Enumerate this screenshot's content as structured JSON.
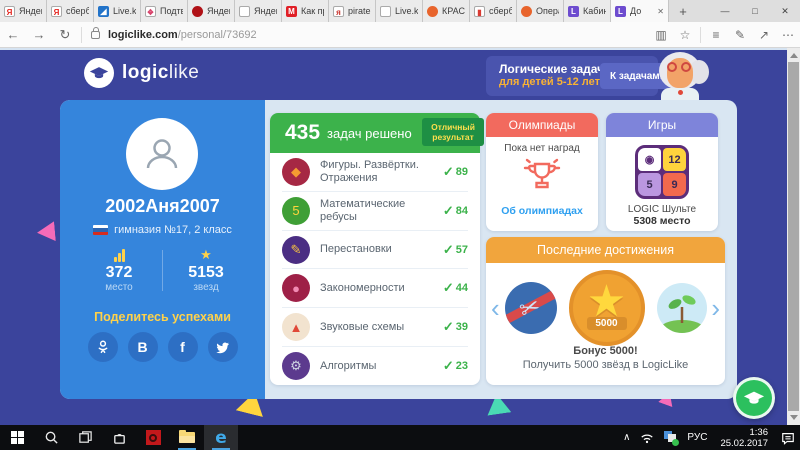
{
  "browser": {
    "tabs": [
      {
        "label": "Яндекс",
        "active": false,
        "icon": {
          "shape": "square",
          "bg": "#ffffff",
          "fg": "#e52620",
          "glyph": "Я",
          "border": true,
          "name": "yandex-favicon"
        }
      },
      {
        "label": "сберб",
        "active": false,
        "icon": {
          "shape": "square",
          "bg": "#ffffff",
          "fg": "#e52620",
          "glyph": "Я",
          "border": true,
          "name": "yandex-favicon"
        }
      },
      {
        "label": "Live.ka",
        "active": false,
        "icon": {
          "shape": "square",
          "bg": "#2273c9",
          "fg": "#ffffff",
          "glyph": "◢",
          "border": false,
          "name": "livejournal-favicon"
        }
      },
      {
        "label": "Подтв",
        "active": false,
        "icon": {
          "shape": "square",
          "bg": "#ffffff",
          "fg": "#d8426b",
          "glyph": "❖",
          "border": true,
          "name": "flower-favicon"
        }
      },
      {
        "label": "Яндекс",
        "active": false,
        "icon": {
          "shape": "circle",
          "bg": "#b01116",
          "fg": "#2a0a0a",
          "glyph": "",
          "border": false,
          "name": "red-circle-favicon"
        }
      },
      {
        "label": "Яндекс",
        "active": false,
        "icon": {
          "shape": "frame",
          "bg": "#ffffff",
          "fg": "#888888",
          "glyph": "",
          "border": true,
          "name": "window-favicon"
        }
      },
      {
        "label": "Как пр",
        "active": false,
        "icon": {
          "shape": "square",
          "bg": "#e01f26",
          "fg": "#ffffff",
          "glyph": "M",
          "border": false,
          "name": "mail-favicon"
        }
      },
      {
        "label": "pirate's",
        "active": false,
        "icon": {
          "shape": "square",
          "bg": "#ffffff",
          "fg": "#c9342e",
          "glyph": "я",
          "border": true,
          "name": "red-letter-favicon"
        }
      },
      {
        "label": "Live.ka",
        "active": false,
        "icon": {
          "shape": "frame",
          "bg": "#ffffff",
          "fg": "#888888",
          "glyph": "",
          "border": true,
          "name": "window-favicon"
        }
      },
      {
        "label": "КРАСИ",
        "active": false,
        "icon": {
          "shape": "circle",
          "bg": "#e8642c",
          "fg": "#ffffff",
          "glyph": "",
          "border": false,
          "name": "orange-favicon"
        }
      },
      {
        "label": "сберба",
        "active": false,
        "icon": {
          "shape": "square",
          "bg": "#ffffff",
          "fg": "#d93a32",
          "glyph": "▮",
          "border": true,
          "name": "sber-favicon"
        }
      },
      {
        "label": "Опера",
        "active": false,
        "icon": {
          "shape": "circle",
          "bg": "#e8642c",
          "fg": "#ffffff",
          "glyph": "",
          "border": false,
          "name": "opera-favicon"
        }
      },
      {
        "label": "Кабин",
        "active": false,
        "icon": {
          "shape": "square",
          "bg": "#6d4ccf",
          "fg": "#ffffff",
          "glyph": "L",
          "border": false,
          "name": "logiclike-favicon"
        }
      },
      {
        "label": "До",
        "active": true,
        "icon": {
          "shape": "square",
          "bg": "#6d4ccf",
          "fg": "#ffffff",
          "glyph": "L",
          "border": false,
          "name": "logiclike-favicon"
        }
      }
    ],
    "new_tab_glyph": "+",
    "close_glyph": "✕",
    "window_controls": {
      "minimize": "—",
      "maximize": "□",
      "close": "✕"
    },
    "toolbar": {
      "back": "←",
      "forward": "→",
      "refresh": "↻",
      "reading_view": "▥",
      "favorite": "☆",
      "hub": "≡",
      "web_note": "✎",
      "share": "↗",
      "more": "⋯"
    },
    "url": {
      "host": "logiclike.com",
      "path": "/personal/73692"
    }
  },
  "header": {
    "logo_bold": "logic",
    "logo_light": "like",
    "banner_line1": "Логические задачи",
    "banner_line2": "для детей 5-12 лет",
    "cta_label": "К задачам!"
  },
  "profile": {
    "name": "2002Аня2007",
    "school": "гимназия №17, 2 класс",
    "rank_value": "372",
    "rank_label": "место",
    "stars_value": "5153",
    "stars_label": "звезд",
    "share_title": "Поделитесь успехами",
    "social": [
      "odnoklassniki",
      "vkontakte",
      "facebook",
      "twitter"
    ]
  },
  "tasks": {
    "count": "435",
    "count_label": "задач решено",
    "badge_line1": "Отличный",
    "badge_line2": "результат",
    "check_glyph": "✓",
    "items": [
      {
        "label": "Фигуры. Развёртки. Отражения",
        "value": "89",
        "icon": {
          "bg": "#a62844",
          "fg": "#f59b31",
          "glyph": "◆"
        }
      },
      {
        "label": "Математические ребусы",
        "value": "84",
        "icon": {
          "bg": "#3f9f36",
          "fg": "#ffd43d",
          "glyph": "5"
        }
      },
      {
        "label": "Перестановки",
        "value": "57",
        "icon": {
          "bg": "#4b2e83",
          "fg": "#f5c242",
          "glyph": "✎"
        }
      },
      {
        "label": "Закономерности",
        "value": "44",
        "icon": {
          "bg": "#9e2047",
          "fg": "#f28bb4",
          "glyph": "●"
        }
      },
      {
        "label": "Звуковые схемы",
        "value": "39",
        "icon": {
          "bg": "#f2e3cf",
          "fg": "#e04838",
          "glyph": "▲"
        }
      },
      {
        "label": "Алгоритмы",
        "value": "23",
        "icon": {
          "bg": "#5c3a8e",
          "fg": "#cfd6e4",
          "glyph": "⚙"
        }
      }
    ]
  },
  "olympiads": {
    "title": "Олимпиады",
    "status": "Пока нет наград",
    "link_label": "Об олимпиадах"
  },
  "game": {
    "title": "Игры",
    "cells": [
      {
        "glyph": "◉",
        "bg": "#ffffff",
        "fg": "#5c2d7a"
      },
      {
        "glyph": "12",
        "bg": "#ffd43d",
        "fg": "#3a2a55"
      },
      {
        "glyph": "5",
        "bg": "#bb97e0",
        "fg": "#3a2a55"
      },
      {
        "glyph": "9",
        "bg": "#f2694d",
        "fg": "#3a2a55"
      }
    ],
    "name": "LOGIC Шульте",
    "rank": "5308 место"
  },
  "achievements": {
    "title": "Последние достижения",
    "prev_glyph": "‹",
    "next_glyph": "›",
    "badges": [
      "scissors-ribbon",
      "star-5000",
      "sprout"
    ],
    "star_glyph": "★",
    "scissors_glyph": "✂",
    "badge_value": "5000",
    "caption_title": "Бонус 5000!",
    "caption_text": "Получить 5000 звёзд в LogicLike"
  },
  "taskbar": {
    "edge_glyph": "e",
    "show_hidden_glyph": "∧",
    "lang": "РУС",
    "time": "1:36",
    "date": "25.02.2017"
  },
  "colors": {
    "page_indigo": "#3b449c",
    "panel_blue": "#3585dc",
    "tasks_green": "#3cb24b",
    "olympiads_coral": "#f26a5e",
    "games_purple": "#7e84da",
    "achievements_orange": "#f1a53d",
    "accent_yellow": "#ffd24a",
    "chat_green": "#2cc05e",
    "link_blue": "#2fa0f0"
  }
}
